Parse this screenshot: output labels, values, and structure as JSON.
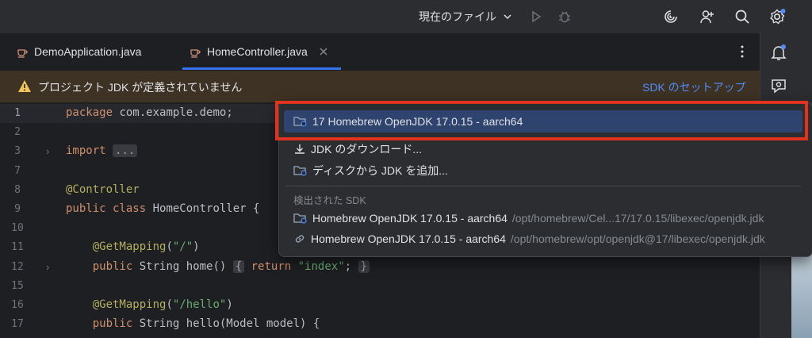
{
  "toolbar": {
    "run_config": "現在のファイル",
    "icons": [
      "chevron-down-icon",
      "run-icon",
      "debug-icon",
      "ai-assistant-icon",
      "add-user-icon",
      "search-icon",
      "settings-icon"
    ]
  },
  "tabs": [
    {
      "label": "DemoApplication.java",
      "active": false
    },
    {
      "label": "HomeController.java",
      "active": true
    }
  ],
  "banner": {
    "message": "プロジェクト JDK が定義されていません",
    "action": "SDK のセットアップ"
  },
  "editor": {
    "lines": [
      {
        "num": "1",
        "tokens": [
          {
            "t": "package",
            "c": "kw"
          },
          {
            "t": " com.example.demo;",
            "c": ""
          }
        ]
      },
      {
        "num": "2",
        "tokens": []
      },
      {
        "num": "3",
        "tokens": [
          {
            "t": "import",
            "c": "kw"
          },
          {
            "t": " ",
            "c": ""
          },
          {
            "t": "...",
            "c": "chip"
          }
        ],
        "fold": "›"
      },
      {
        "num": "7",
        "tokens": []
      },
      {
        "num": "8",
        "tokens": [
          {
            "t": "@Controller",
            "c": "ann"
          }
        ]
      },
      {
        "num": "9",
        "tokens": [
          {
            "t": "public class",
            "c": "kw"
          },
          {
            "t": " HomeController {",
            "c": ""
          }
        ]
      },
      {
        "num": "10",
        "tokens": []
      },
      {
        "num": "11",
        "tokens": [
          {
            "t": "    ",
            "c": ""
          },
          {
            "t": "@GetMapping",
            "c": "ann"
          },
          {
            "t": "(",
            "c": ""
          },
          {
            "t": "\"/\"",
            "c": "str"
          },
          {
            "t": ")",
            "c": ""
          }
        ]
      },
      {
        "num": "12",
        "tokens": [
          {
            "t": "    ",
            "c": ""
          },
          {
            "t": "public",
            "c": "kw"
          },
          {
            "t": " String home() ",
            "c": ""
          },
          {
            "t": "{",
            "c": "chip"
          },
          {
            "t": " ",
            "c": ""
          },
          {
            "t": "return",
            "c": "kw"
          },
          {
            "t": " ",
            "c": ""
          },
          {
            "t": "\"index\"",
            "c": "str"
          },
          {
            "t": "; ",
            "c": ""
          },
          {
            "t": "}",
            "c": "chip"
          }
        ],
        "fold": "›"
      },
      {
        "num": "15",
        "tokens": []
      },
      {
        "num": "16",
        "tokens": [
          {
            "t": "    ",
            "c": ""
          },
          {
            "t": "@GetMapping",
            "c": "ann"
          },
          {
            "t": "(",
            "c": ""
          },
          {
            "t": "\"/hello\"",
            "c": "str"
          },
          {
            "t": ")",
            "c": ""
          }
        ]
      },
      {
        "num": "17",
        "tokens": [
          {
            "t": "    ",
            "c": ""
          },
          {
            "t": "public",
            "c": "kw"
          },
          {
            "t": " String hello(Model model) {",
            "c": ""
          }
        ]
      }
    ]
  },
  "popup": {
    "selected_item": "17 Homebrew OpenJDK 17.0.15 - aarch64",
    "download_item": "JDK のダウンロード...",
    "add_from_disk_item": "ディスクから JDK を追加...",
    "detected_header": "検出された SDK",
    "detected": [
      {
        "name": "Homebrew OpenJDK 17.0.15 - aarch64",
        "path": "/opt/homebrew/Cel...17/17.0.15/libexec/openjdk.jdk"
      },
      {
        "name": "Homebrew OpenJDK 17.0.15 - aarch64",
        "path": "/opt/homebrew/opt/openjdk@17/libexec/openjdk.jdk"
      }
    ]
  },
  "colors": {
    "highlight_border": "#e0321e",
    "selection": "#2e436e",
    "accent": "#3574f0",
    "warning_banner": "#3d3223",
    "link": "#548af7"
  }
}
